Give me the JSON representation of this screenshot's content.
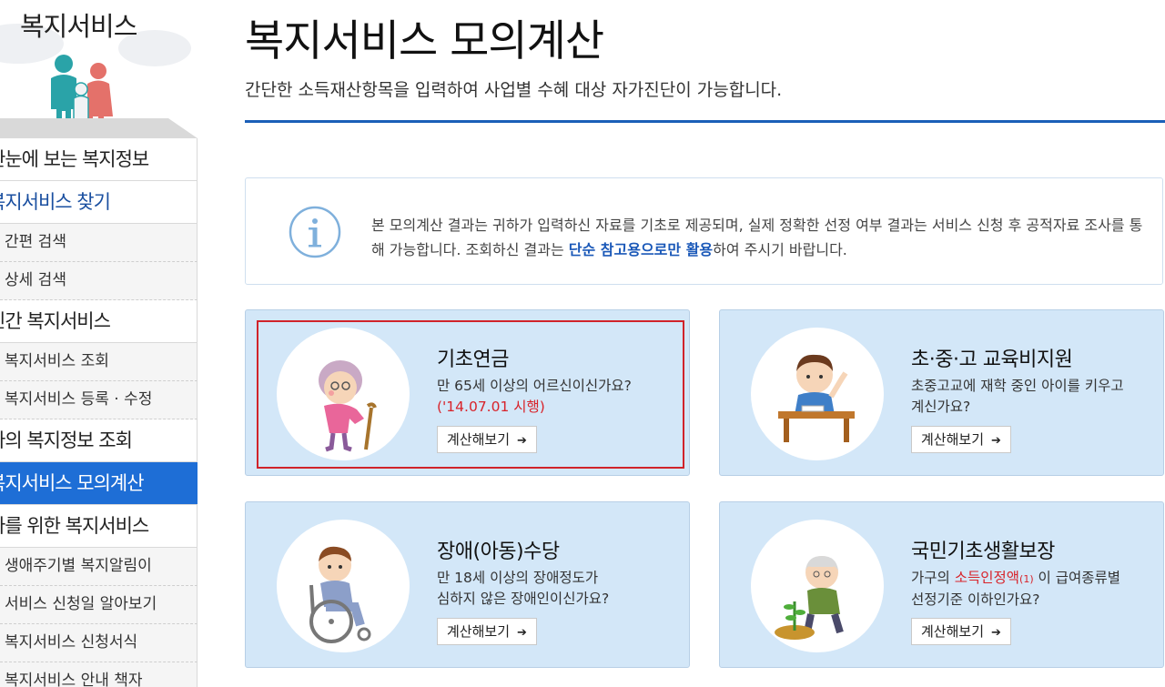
{
  "sidebar": {
    "title": "복지서비스",
    "menu": [
      {
        "label": "한눈에 보는 복지정보",
        "level": 1
      },
      {
        "label": "복지서비스 찾기",
        "level": 1,
        "accent": true
      },
      {
        "label": "간편 검색",
        "level": 2
      },
      {
        "label": "상세 검색",
        "level": 2
      },
      {
        "label": "민간 복지서비스",
        "level": 1
      },
      {
        "label": "복지서비스 조회",
        "level": 2
      },
      {
        "label": "복지서비스 등록 · 수정",
        "level": 2
      },
      {
        "label": "나의 복지정보 조회",
        "level": 1
      },
      {
        "label": "복지서비스 모의계산",
        "level": 1,
        "active": true
      },
      {
        "label": "나를 위한 복지서비스",
        "level": 1
      },
      {
        "label": "생애주기별 복지알림이",
        "level": 2
      },
      {
        "label": "서비스 신청일 알아보기",
        "level": 2
      },
      {
        "label": "복지서비스 신청서식",
        "level": 2
      },
      {
        "label": "복지서비스 안내 책자",
        "level": 2
      }
    ]
  },
  "page": {
    "title": "복지서비스 모의계산",
    "subtitle": "간단한 소득재산항목을 입력하여 사업별 수혜 대상 자가진단이 가능합니다."
  },
  "notice": {
    "icon": "info-icon",
    "text_before": "본 모의계산 결과는 귀하가 입력하신 자료를 기초로 제공되며, 실제 정확한 선정 여부 결과는 서비스 신청 후 공적자료 조사를 통해 가능합니다. 조회하신 결과는 ",
    "text_highlight": "단순 참고용으로만 활용",
    "text_after": "하여 주시기 바랍니다."
  },
  "cards": [
    {
      "title": "기초연금",
      "line1": "만 65세 이상의 어르신이신가요?",
      "note": "('14.07.01 시행)",
      "button": "계산해보기",
      "icon": "elderly-woman-icon"
    },
    {
      "title": "초·중·고 교육비지원",
      "line1": "초중고교에 재학 중인 아이를 키우고",
      "line2": "계신가요?",
      "button": "계산해보기",
      "icon": "student-icon"
    },
    {
      "title": "장애(아동)수당",
      "line1": "만 18세 이상의 장애정도가",
      "line2": "심하지 않은 장애인이신가요?",
      "button": "계산해보기",
      "icon": "wheelchair-icon"
    },
    {
      "title": "국민기초생활보장",
      "line1_pre": "가구의 ",
      "line1_red": "소득인정액",
      "line1_sup": "(1)",
      "line1_post": " 이 급여종류별",
      "line2": "선정기준 이하인가요?",
      "button": "계산해보기",
      "icon": "gardening-man-icon"
    }
  ],
  "colors": {
    "active_menu": "#1e6ed6",
    "card_bg": "#d3e7f8",
    "accent_blue": "#1b5fb8",
    "highlight_red": "#d0232a"
  }
}
